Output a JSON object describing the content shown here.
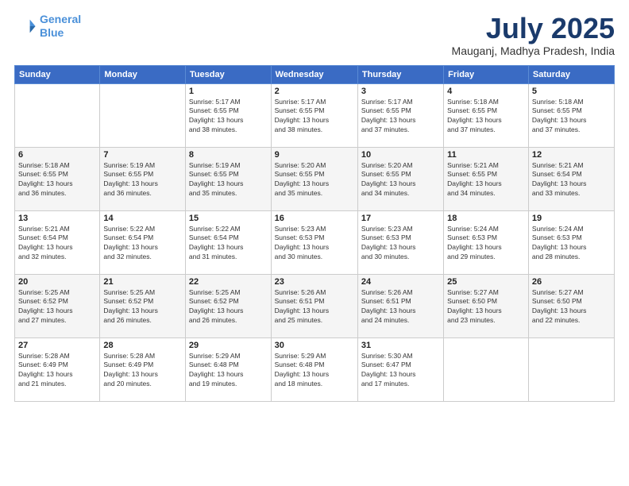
{
  "logo": {
    "line1": "General",
    "line2": "Blue"
  },
  "title": "July 2025",
  "location": "Mauganj, Madhya Pradesh, India",
  "weekdays": [
    "Sunday",
    "Monday",
    "Tuesday",
    "Wednesday",
    "Thursday",
    "Friday",
    "Saturday"
  ],
  "weeks": [
    [
      {
        "day": "",
        "info": ""
      },
      {
        "day": "",
        "info": ""
      },
      {
        "day": "1",
        "info": "Sunrise: 5:17 AM\nSunset: 6:55 PM\nDaylight: 13 hours\nand 38 minutes."
      },
      {
        "day": "2",
        "info": "Sunrise: 5:17 AM\nSunset: 6:55 PM\nDaylight: 13 hours\nand 38 minutes."
      },
      {
        "day": "3",
        "info": "Sunrise: 5:17 AM\nSunset: 6:55 PM\nDaylight: 13 hours\nand 37 minutes."
      },
      {
        "day": "4",
        "info": "Sunrise: 5:18 AM\nSunset: 6:55 PM\nDaylight: 13 hours\nand 37 minutes."
      },
      {
        "day": "5",
        "info": "Sunrise: 5:18 AM\nSunset: 6:55 PM\nDaylight: 13 hours\nand 37 minutes."
      }
    ],
    [
      {
        "day": "6",
        "info": "Sunrise: 5:18 AM\nSunset: 6:55 PM\nDaylight: 13 hours\nand 36 minutes."
      },
      {
        "day": "7",
        "info": "Sunrise: 5:19 AM\nSunset: 6:55 PM\nDaylight: 13 hours\nand 36 minutes."
      },
      {
        "day": "8",
        "info": "Sunrise: 5:19 AM\nSunset: 6:55 PM\nDaylight: 13 hours\nand 35 minutes."
      },
      {
        "day": "9",
        "info": "Sunrise: 5:20 AM\nSunset: 6:55 PM\nDaylight: 13 hours\nand 35 minutes."
      },
      {
        "day": "10",
        "info": "Sunrise: 5:20 AM\nSunset: 6:55 PM\nDaylight: 13 hours\nand 34 minutes."
      },
      {
        "day": "11",
        "info": "Sunrise: 5:21 AM\nSunset: 6:55 PM\nDaylight: 13 hours\nand 34 minutes."
      },
      {
        "day": "12",
        "info": "Sunrise: 5:21 AM\nSunset: 6:54 PM\nDaylight: 13 hours\nand 33 minutes."
      }
    ],
    [
      {
        "day": "13",
        "info": "Sunrise: 5:21 AM\nSunset: 6:54 PM\nDaylight: 13 hours\nand 32 minutes."
      },
      {
        "day": "14",
        "info": "Sunrise: 5:22 AM\nSunset: 6:54 PM\nDaylight: 13 hours\nand 32 minutes."
      },
      {
        "day": "15",
        "info": "Sunrise: 5:22 AM\nSunset: 6:54 PM\nDaylight: 13 hours\nand 31 minutes."
      },
      {
        "day": "16",
        "info": "Sunrise: 5:23 AM\nSunset: 6:53 PM\nDaylight: 13 hours\nand 30 minutes."
      },
      {
        "day": "17",
        "info": "Sunrise: 5:23 AM\nSunset: 6:53 PM\nDaylight: 13 hours\nand 30 minutes."
      },
      {
        "day": "18",
        "info": "Sunrise: 5:24 AM\nSunset: 6:53 PM\nDaylight: 13 hours\nand 29 minutes."
      },
      {
        "day": "19",
        "info": "Sunrise: 5:24 AM\nSunset: 6:53 PM\nDaylight: 13 hours\nand 28 minutes."
      }
    ],
    [
      {
        "day": "20",
        "info": "Sunrise: 5:25 AM\nSunset: 6:52 PM\nDaylight: 13 hours\nand 27 minutes."
      },
      {
        "day": "21",
        "info": "Sunrise: 5:25 AM\nSunset: 6:52 PM\nDaylight: 13 hours\nand 26 minutes."
      },
      {
        "day": "22",
        "info": "Sunrise: 5:25 AM\nSunset: 6:52 PM\nDaylight: 13 hours\nand 26 minutes."
      },
      {
        "day": "23",
        "info": "Sunrise: 5:26 AM\nSunset: 6:51 PM\nDaylight: 13 hours\nand 25 minutes."
      },
      {
        "day": "24",
        "info": "Sunrise: 5:26 AM\nSunset: 6:51 PM\nDaylight: 13 hours\nand 24 minutes."
      },
      {
        "day": "25",
        "info": "Sunrise: 5:27 AM\nSunset: 6:50 PM\nDaylight: 13 hours\nand 23 minutes."
      },
      {
        "day": "26",
        "info": "Sunrise: 5:27 AM\nSunset: 6:50 PM\nDaylight: 13 hours\nand 22 minutes."
      }
    ],
    [
      {
        "day": "27",
        "info": "Sunrise: 5:28 AM\nSunset: 6:49 PM\nDaylight: 13 hours\nand 21 minutes."
      },
      {
        "day": "28",
        "info": "Sunrise: 5:28 AM\nSunset: 6:49 PM\nDaylight: 13 hours\nand 20 minutes."
      },
      {
        "day": "29",
        "info": "Sunrise: 5:29 AM\nSunset: 6:48 PM\nDaylight: 13 hours\nand 19 minutes."
      },
      {
        "day": "30",
        "info": "Sunrise: 5:29 AM\nSunset: 6:48 PM\nDaylight: 13 hours\nand 18 minutes."
      },
      {
        "day": "31",
        "info": "Sunrise: 5:30 AM\nSunset: 6:47 PM\nDaylight: 13 hours\nand 17 minutes."
      },
      {
        "day": "",
        "info": ""
      },
      {
        "day": "",
        "info": ""
      }
    ]
  ]
}
